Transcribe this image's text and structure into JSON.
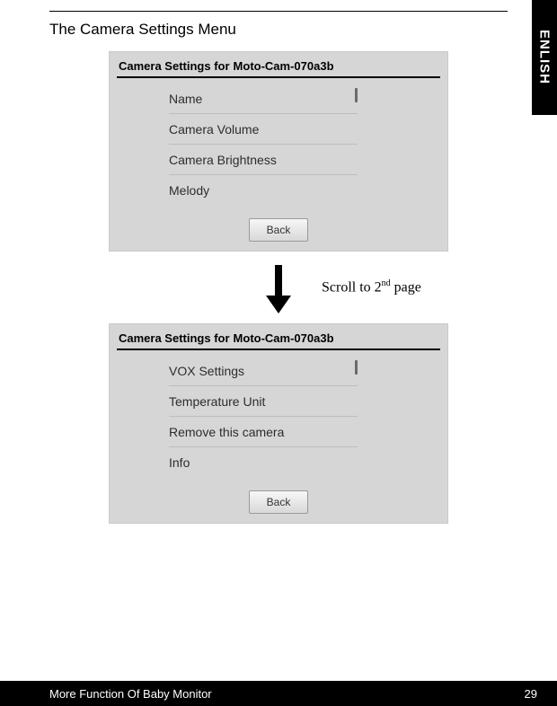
{
  "section_title": "The Camera Settings Menu",
  "side_tab": "ENLISH",
  "screens": [
    {
      "header_caption": "Camera Settings for",
      "header_camera": "Moto-Cam-070a3b",
      "items": [
        "Name",
        "Camera Volume",
        "Camera Brightness",
        "Melody"
      ],
      "back_label": "Back",
      "scroll_thumb_on_first": true
    },
    {
      "header_caption": "Camera Settings for",
      "header_camera": "Moto-Cam-070a3b",
      "items": [
        "VOX Settings",
        "Temperature Unit",
        "Remove this camera",
        "Info"
      ],
      "back_label": "Back",
      "scroll_thumb_on_first": true
    }
  ],
  "arrow_label": {
    "prefix": "Scroll to 2",
    "sup": "nd",
    "suffix": " page"
  },
  "footer": {
    "left": "More Function Of Baby Monitor",
    "right": "29"
  }
}
